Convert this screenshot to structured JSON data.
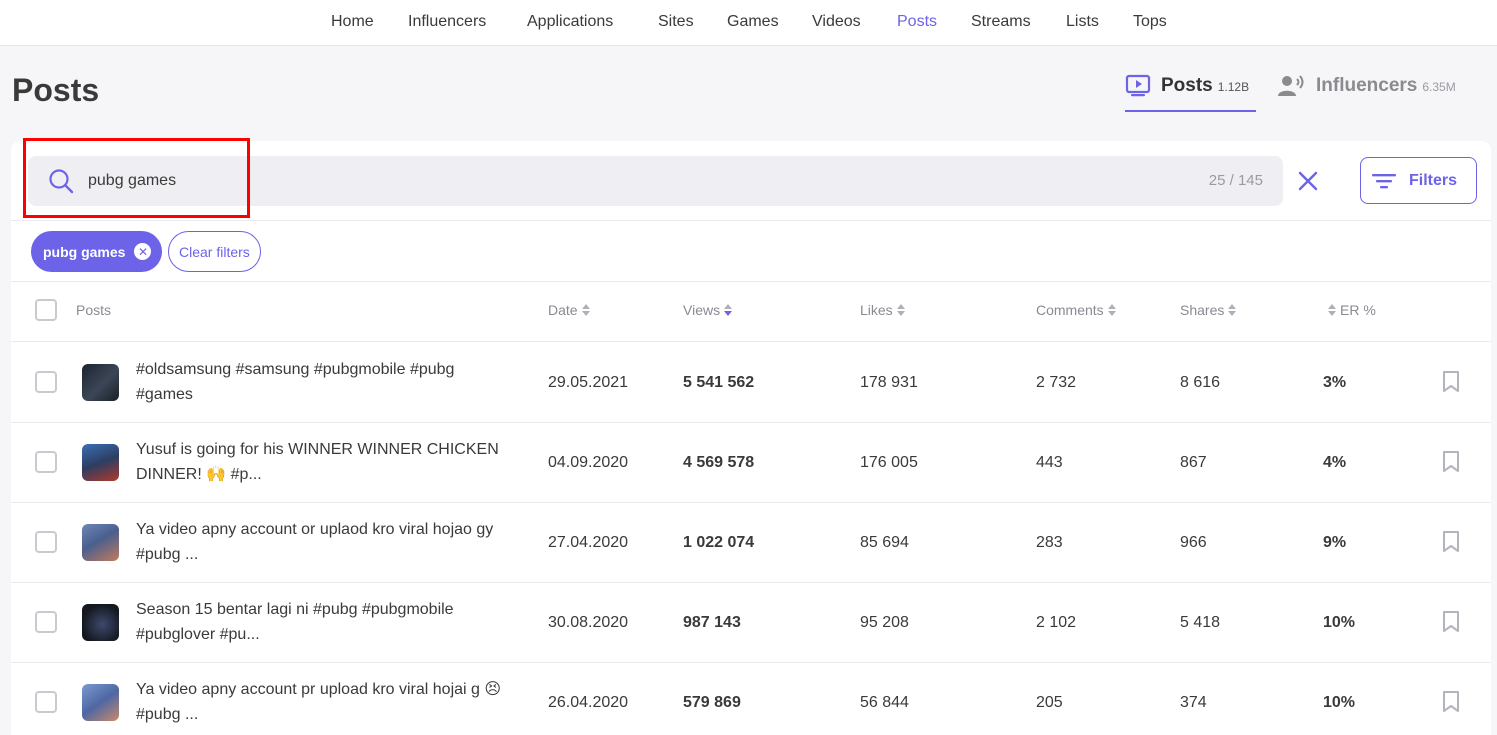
{
  "nav": {
    "items": [
      "Home",
      "Influencers",
      "Applications",
      "Sites",
      "Games",
      "Videos",
      "Posts",
      "Streams",
      "Lists",
      "Tops"
    ],
    "active": "Posts"
  },
  "page": {
    "title": "Posts"
  },
  "mode_tabs": [
    {
      "label": "Posts",
      "count": "1.12B",
      "active": true,
      "icon": "play-screen-icon"
    },
    {
      "label": "Influencers",
      "count": "6.35M",
      "active": false,
      "icon": "speaker-person-icon"
    }
  ],
  "search": {
    "value": "pubg games",
    "placeholder": "",
    "counter": "25 / 145"
  },
  "filters_button": {
    "label": "Filters"
  },
  "active_filters": {
    "chip": "pubg games",
    "clear_label": "Clear filters"
  },
  "table": {
    "headers": {
      "posts": "Posts",
      "date": "Date",
      "views": "Views",
      "likes": "Likes",
      "comments": "Comments",
      "shares": "Shares",
      "er": "ER %"
    },
    "rows": [
      {
        "title": "#oldsamsung #samsung #pubgmobile #pubg #games",
        "date": "29.05.2021",
        "views": "5 541 562",
        "likes": "178 931",
        "comments": "2 732",
        "shares": "8 616",
        "er": "3%"
      },
      {
        "title": "Yusuf is going for his WINNER WINNER CHICKEN DINNER! 🙌 #p...",
        "date": "04.09.2020",
        "views": "4 569 578",
        "likes": "176 005",
        "comments": "443",
        "shares": "867",
        "er": "4%"
      },
      {
        "title": "Ya video apny account or uplaod kro viral hojao gy #pubg ...",
        "date": "27.04.2020",
        "views": "1 022 074",
        "likes": "85 694",
        "comments": "283",
        "shares": "966",
        "er": "9%"
      },
      {
        "title": "Season 15 bentar lagi ni #pubg #pubgmobile #pubglover #pu...",
        "date": "30.08.2020",
        "views": "987 143",
        "likes": "95 208",
        "comments": "2 102",
        "shares": "5 418",
        "er": "10%"
      },
      {
        "title": "Ya video apny account pr upload kro viral hojai g 😣#pubg ...",
        "date": "26.04.2020",
        "views": "579 869",
        "likes": "56 844",
        "comments": "205",
        "shares": "374",
        "er": "10%"
      }
    ]
  },
  "colors": {
    "accent": "#6c63e8",
    "highlight": "#ff0000"
  }
}
